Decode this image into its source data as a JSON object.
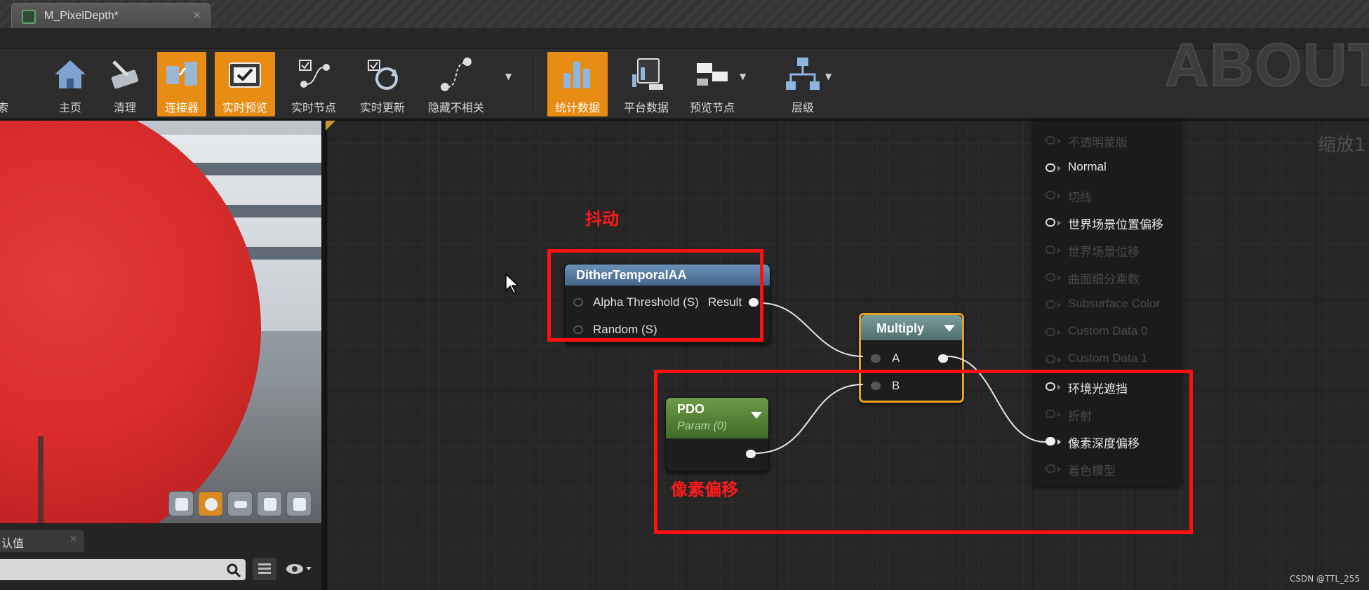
{
  "window": {
    "tab_title": "M_PixelDepth*",
    "tab_close": "×",
    "watermark": "ABOUTC"
  },
  "toolbar": {
    "items": [
      {
        "label": "索",
        "icon": "search-icon",
        "active": false
      },
      {
        "label": "主页",
        "icon": "home-icon",
        "active": false
      },
      {
        "label": "清理",
        "icon": "clean-icon",
        "active": false
      },
      {
        "label": "连接器",
        "icon": "connector-icon",
        "active": true
      },
      {
        "label": "实时预览",
        "icon": "live-preview-icon",
        "active": true
      },
      {
        "label": "实时节点",
        "icon": "live-nodes-icon",
        "active": false
      },
      {
        "label": "实时更新",
        "icon": "live-update-icon",
        "active": false
      },
      {
        "label": "隐藏不相关",
        "icon": "hide-unrelated-icon",
        "active": false
      },
      {
        "label": "统计数据",
        "icon": "stats-icon",
        "active": true
      },
      {
        "label": "平台数据",
        "icon": "platform-stats-icon",
        "active": false
      },
      {
        "label": "预览节点",
        "icon": "preview-nodes-icon",
        "active": false
      },
      {
        "label": "层级",
        "icon": "hierarchy-icon",
        "active": false
      }
    ]
  },
  "details": {
    "tab_label": "认值",
    "tab_close": "×",
    "search_placeholder": ""
  },
  "graph": {
    "zoom_label": "缩放1",
    "nodes": {
      "dither": {
        "title": "DitherTemporalAA",
        "inputs": [
          "Alpha Threshold (S)",
          "Random (S)"
        ],
        "output": "Result"
      },
      "multiply": {
        "title": "Multiply",
        "inputs": [
          "A",
          "B"
        ]
      },
      "pdo": {
        "title": "PDO",
        "subtitle": "Param (0)"
      }
    },
    "result_pins": [
      {
        "label": "不透明蒙版",
        "enabled": false,
        "connected": false
      },
      {
        "label": "Normal",
        "enabled": true,
        "connected": false
      },
      {
        "label": "切线",
        "enabled": false,
        "connected": false
      },
      {
        "label": "世界场景位置偏移",
        "enabled": true,
        "connected": false
      },
      {
        "label": "世界场景位移",
        "enabled": false,
        "connected": false
      },
      {
        "label": "曲面细分乘数",
        "enabled": false,
        "connected": false
      },
      {
        "label": "Subsurface Color",
        "enabled": false,
        "connected": false
      },
      {
        "label": "Custom Data 0",
        "enabled": false,
        "connected": false
      },
      {
        "label": "Custom Data 1",
        "enabled": false,
        "connected": false
      },
      {
        "label": "环境光遮挡",
        "enabled": true,
        "connected": false
      },
      {
        "label": "折射",
        "enabled": false,
        "connected": false
      },
      {
        "label": "像素深度偏移",
        "enabled": true,
        "connected": true
      },
      {
        "label": "着色模型",
        "enabled": false,
        "connected": false
      }
    ]
  },
  "annotations": {
    "dither_label": "抖动",
    "pdo_label": "像素偏移",
    "color": "#ff1010"
  },
  "credit": "CSDN @TTL_255",
  "colors": {
    "accent": "#e88c13",
    "dither_header": "#5a7fa6",
    "multiply_header": "#5a7a7a",
    "pdo_header": "#5c8a3a",
    "selection": "#e8a020"
  }
}
